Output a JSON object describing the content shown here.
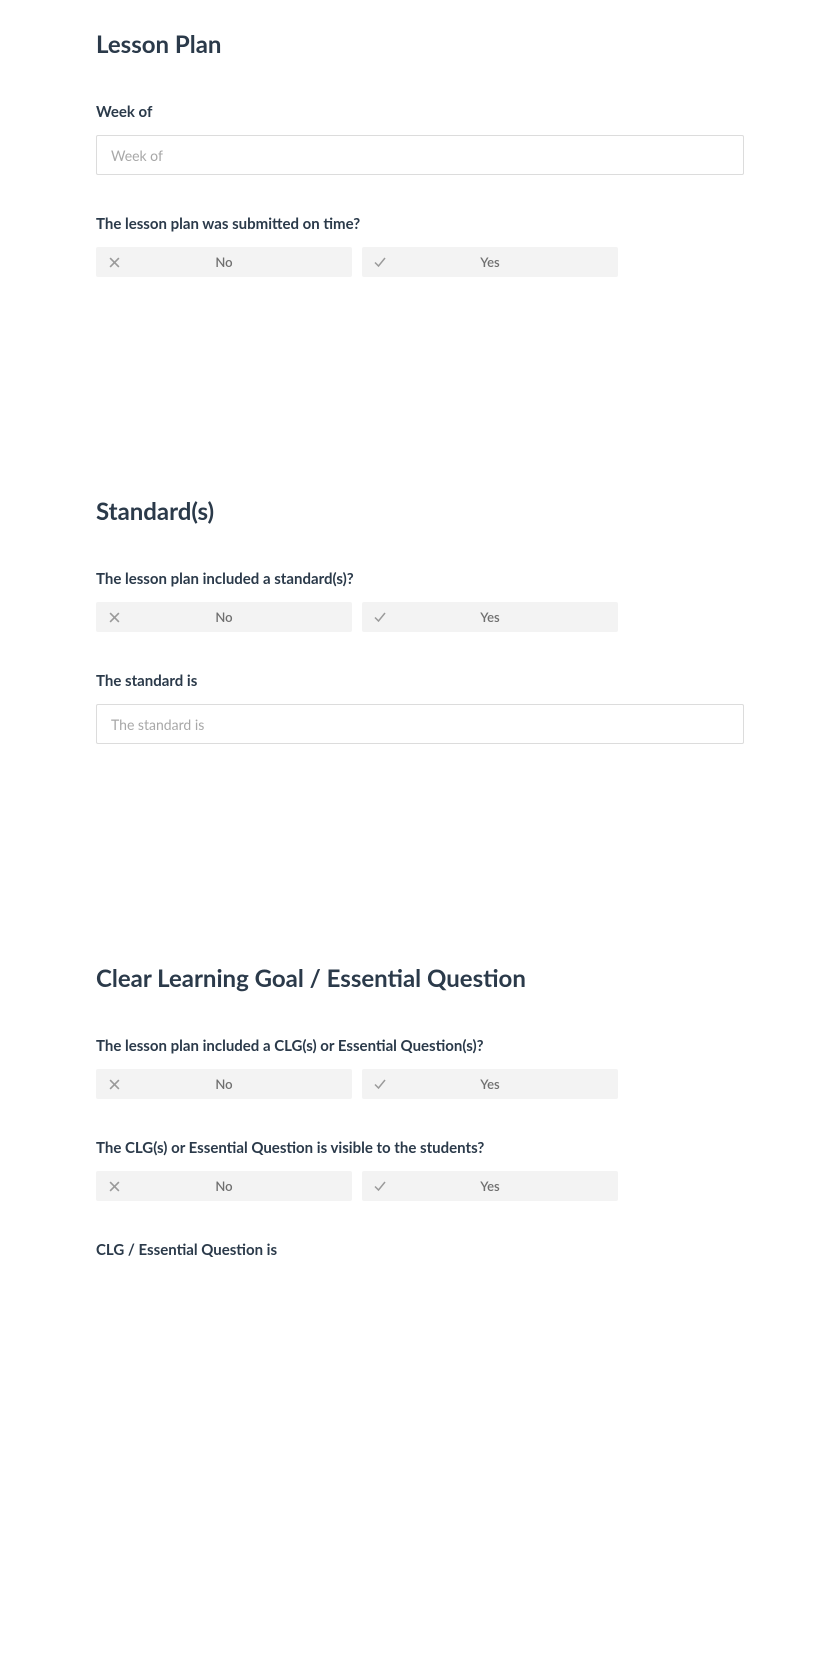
{
  "sections": {
    "lessonPlan": {
      "title": "Lesson Plan",
      "fields": {
        "weekOf": {
          "label": "Week of",
          "placeholder": "Week of",
          "value": ""
        },
        "submittedOnTime": {
          "label": "The lesson plan was submitted on time?",
          "options": {
            "no": "No",
            "yes": "Yes"
          }
        }
      }
    },
    "standards": {
      "title": "Standard(s)",
      "fields": {
        "includedStandard": {
          "label": "The lesson plan included a standard(s)?",
          "options": {
            "no": "No",
            "yes": "Yes"
          }
        },
        "standardIs": {
          "label": "The standard is",
          "placeholder": "The standard is",
          "value": ""
        }
      }
    },
    "clg": {
      "title": "Clear Learning Goal / Essential Question",
      "fields": {
        "includedClg": {
          "label": "The lesson plan included a CLG(s) or Essential Question(s)?",
          "options": {
            "no": "No",
            "yes": "Yes"
          }
        },
        "clgVisible": {
          "label": "The CLG(s) or Essential Question is visible to the students?",
          "options": {
            "no": "No",
            "yes": "Yes"
          }
        },
        "clgIs": {
          "label": "CLG / Essential Question is"
        }
      }
    }
  },
  "icons": {
    "x": "x-icon",
    "check": "check-icon"
  }
}
